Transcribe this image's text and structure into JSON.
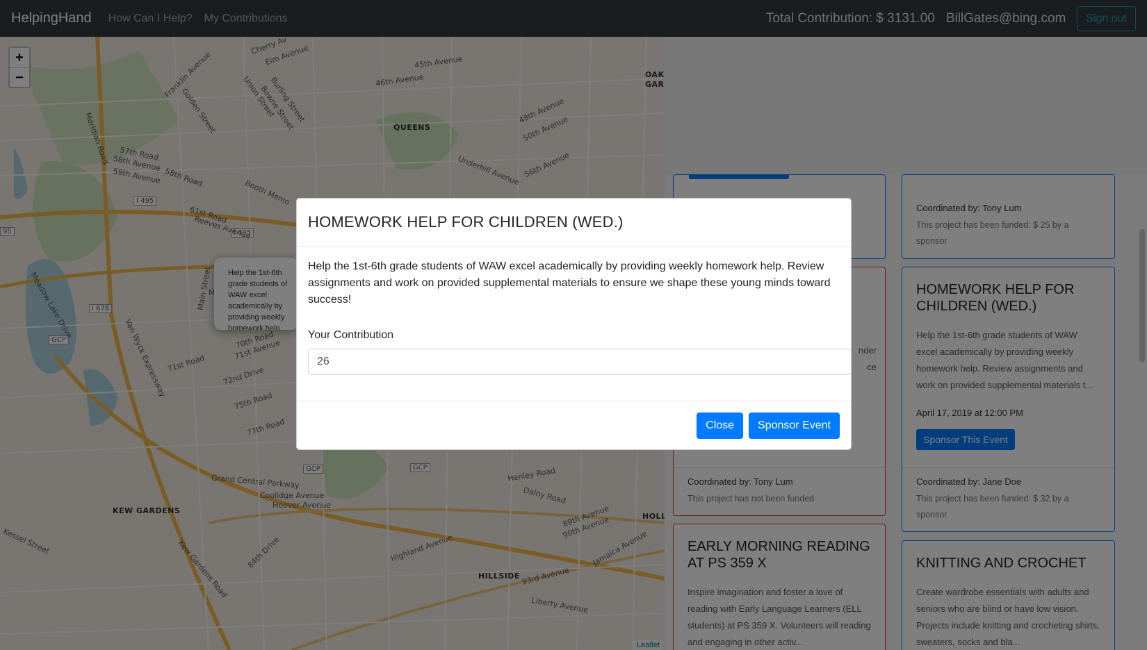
{
  "navbar": {
    "brand": "HelpingHand",
    "links": [
      "How Can I Help?",
      "My Contributions"
    ],
    "total": "Total Contribution: $ 3131.00",
    "email": "BillGates@bing.com",
    "signout": "Sign out"
  },
  "map": {
    "zoom_in": "+",
    "zoom_out": "−",
    "attribution": "Leaflet",
    "popup_text": "Help the 1st-6th grade students of WAW excel academically by providing weekly homework help. Review assignments and work on provided supplemental materials to ensure we shape these young minds toward success!",
    "labels": [
      "QUEENS",
      "KEW GARDENS",
      "HILLSIDE",
      "HOLLI",
      "OAKL GARD",
      "I 495",
      "I 495",
      "I 678",
      "GCP",
      "GCP",
      "GCP",
      "95",
      "45th Avenue",
      "46th Avenue",
      "48th Avenue",
      "50th Avenue",
      "56th Avenue",
      "57th Road",
      "58th Avenue",
      "59th Avenue",
      "58th Road",
      "61st Road",
      "Reeves Avenue",
      "Booth Memo",
      "Underhill Avenue",
      "70th Road",
      "71st Avenue",
      "71st Road",
      "72nd Drive",
      "75th Road",
      "77th Road",
      "Grand Central Parkway",
      "Coolidge Avenue",
      "Hoover Avenue",
      "Henley Road",
      "Dalny Road",
      "Highland Avenue",
      "89th Avenue",
      "90th Avenue",
      "93rd Avenue",
      "Liberty Avenue",
      "Jamaica Avenue",
      "Main Street",
      "Meridian Road",
      "Franklin Avenue",
      "Cherry Av",
      "Elm Avenue",
      "Union Street",
      "Bowne Street",
      "Burling Street",
      "Golden Street",
      "Van Wyck Expressway",
      "Meadow Lake Drive",
      "Kessel Street",
      "Kew Gardens Road",
      "84th Drive",
      "Melbo"
    ]
  },
  "cards": [
    {
      "title": "",
      "desc": "",
      "coordinator": "",
      "funded": ""
    },
    {
      "title": "",
      "desc": "",
      "coordinator": "Coordinated by: Tony Lum",
      "funded": "This project has been funded: $ 25 by a sponsor"
    },
    {
      "title": "",
      "desc": "nder ce",
      "coordinator": "Coordinated by: Tony Lum",
      "funded": "This project has not been funded"
    },
    {
      "title": "HOMEWORK HELP FOR CHILDREN (WED.)",
      "desc": "Help the 1st-6th grade students of WAW excel academically by providing weekly homework help. Review assignments and work on provided supplemental materials t...",
      "date": "April 17, 2019 at 12:00 PM",
      "button": "Sponsor This Event",
      "coordinator": "Coordinated by: Jane Doe",
      "funded": "This project has been funded: $ 32 by a sponsor"
    },
    {
      "title": "EARLY MORNING READING AT PS 359 X",
      "desc": "Inspire imagination and foster a love of reading with Early Language Learners (ELL students) at PS 359 X. Volunteers will reading and engaging in other activ..."
    },
    {
      "title": "KNITTING AND CROCHET",
      "desc": "Create wardrobe essentials with adults and seniors who are blind or have low vision. Projects include knitting and crocheting shirts, sweaters, socks and bla..."
    }
  ],
  "modal": {
    "title": "HOMEWORK HELP FOR CHILDREN (WED.)",
    "description": "Help the 1st-6th grade students of WAW excel academically by providing weekly homework help. Review assignments and work on provided supplemental materials to ensure we shape these young minds toward success!",
    "contribution_label": "Your Contribution",
    "contribution_value": "26",
    "close_label": "Close",
    "sponsor_label": "Sponsor Event"
  },
  "colors": {
    "navbar": "#343a40",
    "primary": "#007bff",
    "danger": "#dc3545",
    "info": "#17a2b8"
  }
}
